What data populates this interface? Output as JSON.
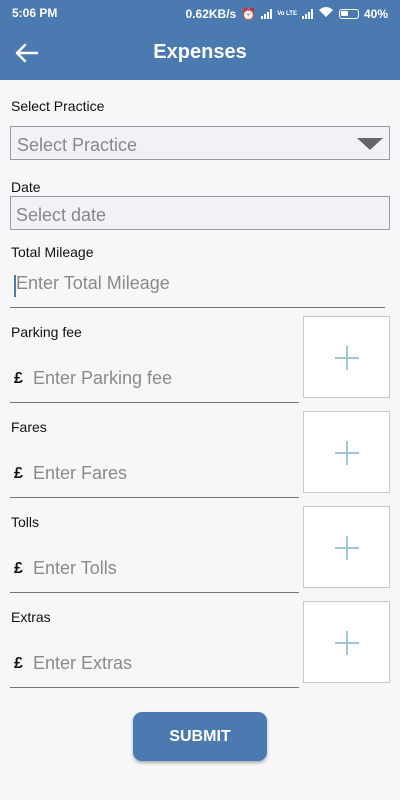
{
  "status_bar": {
    "time": "5:06 PM",
    "speed": "0.62KB/s",
    "volte": "Vo LTE",
    "battery": "40%"
  },
  "header": {
    "title": "Expenses",
    "back_icon": "arrow-left-icon"
  },
  "form": {
    "practice": {
      "label": "Select Practice",
      "placeholder": "Select Practice"
    },
    "date": {
      "label": "Date",
      "placeholder": "Select date"
    },
    "mileage": {
      "label": "Total Mileage",
      "placeholder": "Enter Total Mileage"
    },
    "currency_symbol": "£",
    "expenses": [
      {
        "label": "Parking fee",
        "placeholder": "Enter Parking fee"
      },
      {
        "label": "Fares",
        "placeholder": "Enter Fares"
      },
      {
        "label": "Tolls",
        "placeholder": "Enter Tolls"
      },
      {
        "label": "Extras",
        "placeholder": "Enter Extras"
      }
    ],
    "submit_label": "SUBMIT"
  },
  "colors": {
    "primary": "#4b7ab0",
    "plus_icon": "#9fc8d8"
  }
}
